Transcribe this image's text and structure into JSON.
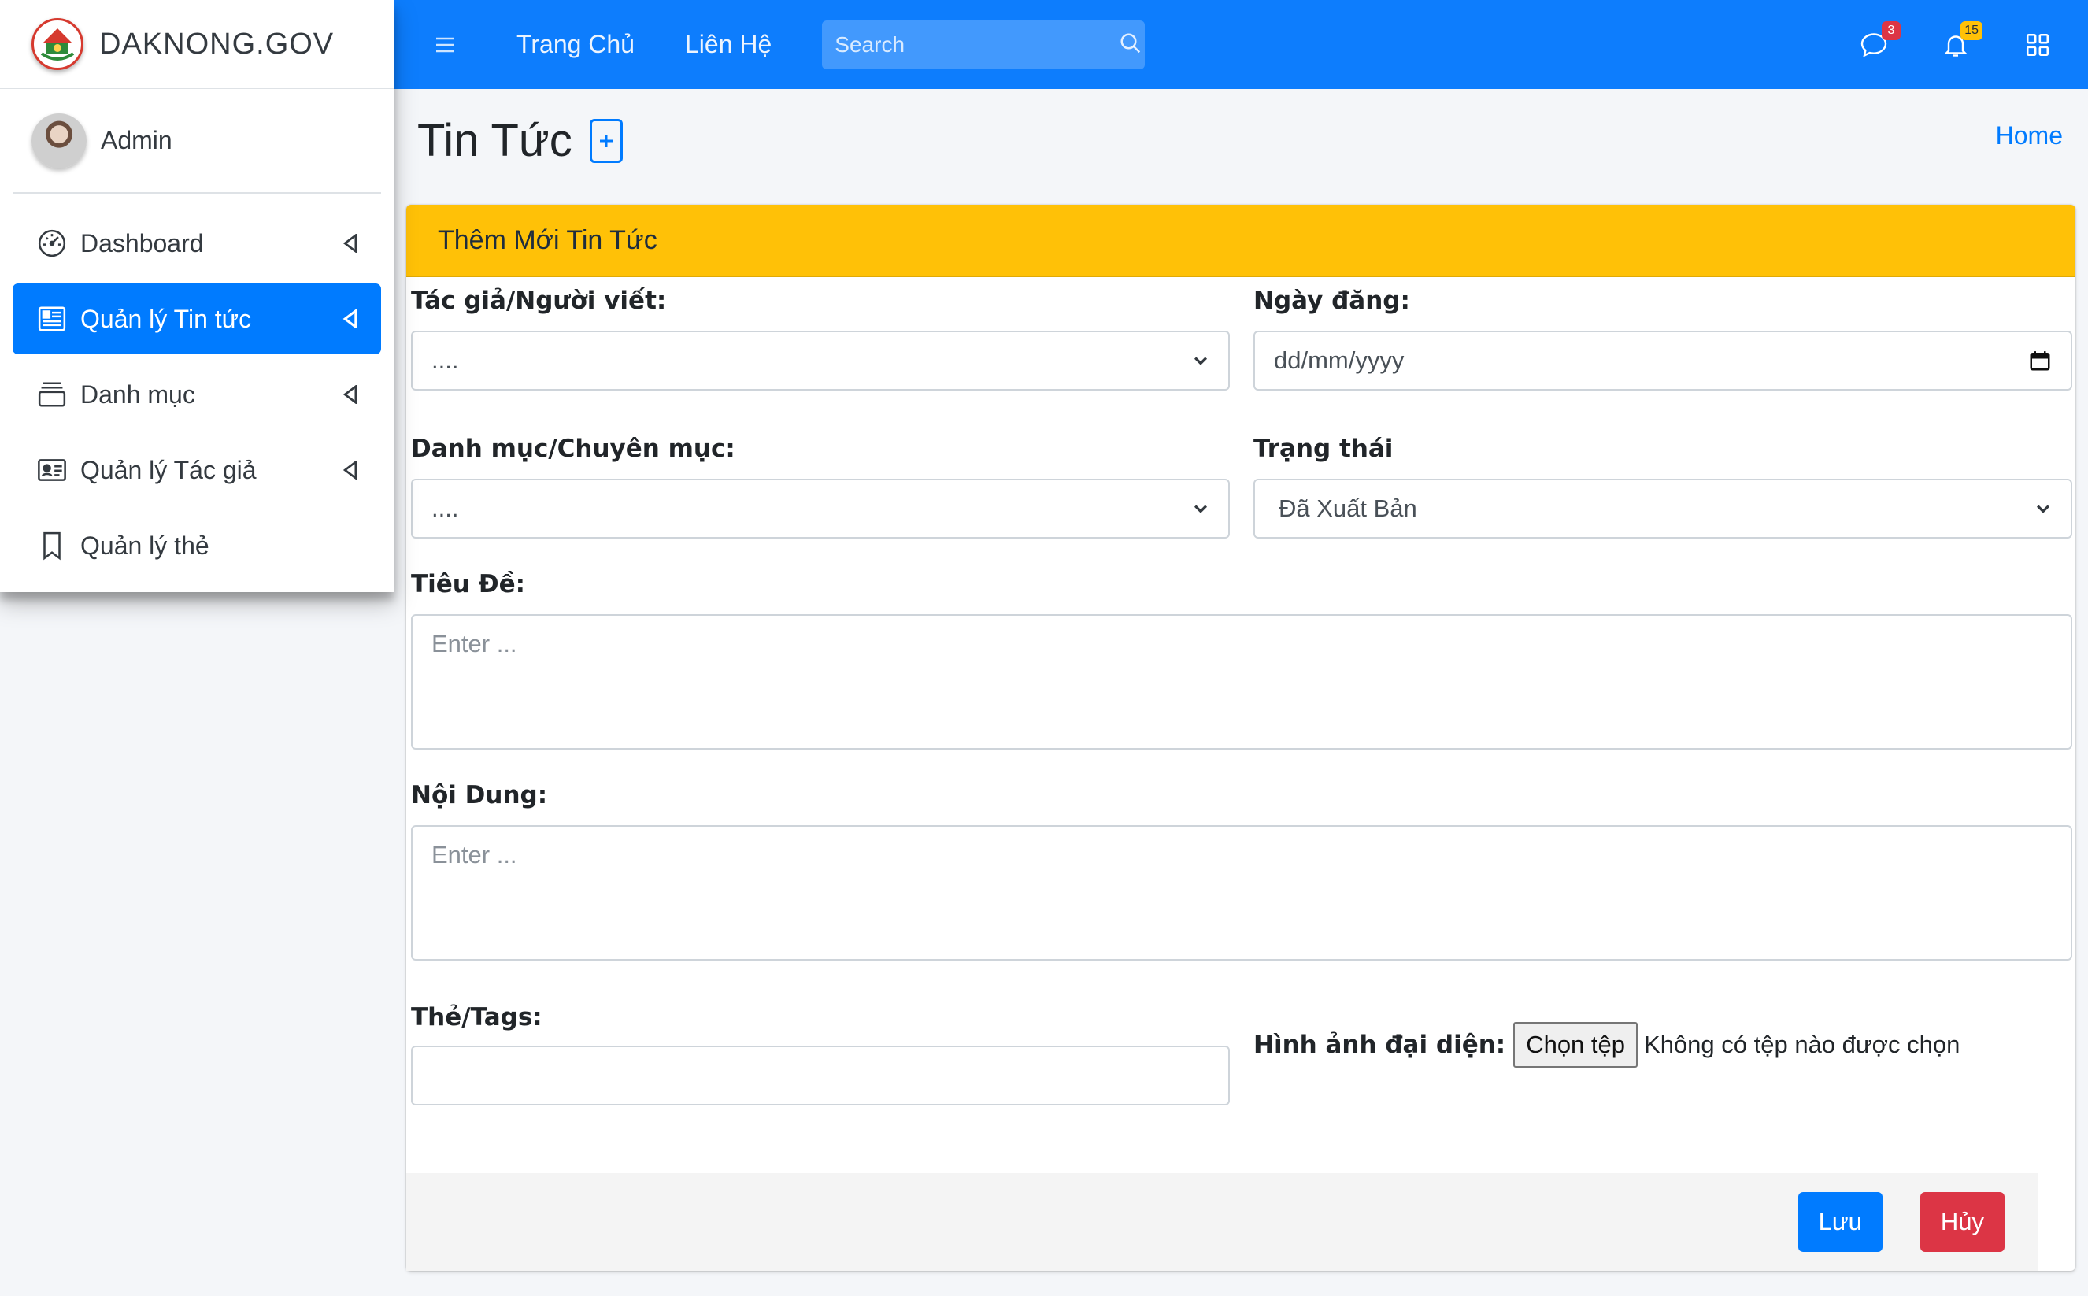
{
  "brand": {
    "name": "DAKNONG.GOV"
  },
  "user": {
    "name": "Admin"
  },
  "sidebar": {
    "items": [
      {
        "label": "Dashboard",
        "icon": "dashboard-gauge-icon",
        "active": false,
        "has_caret": true
      },
      {
        "label": "Quản lý Tin tức",
        "icon": "newspaper-icon",
        "active": true,
        "has_caret": true
      },
      {
        "label": "Danh mục",
        "icon": "layers-icon",
        "active": false,
        "has_caret": true
      },
      {
        "label": "Quản lý Tác giả",
        "icon": "id-card-icon",
        "active": false,
        "has_caret": true
      },
      {
        "label": "Quản lý thẻ",
        "icon": "bookmark-icon",
        "active": false,
        "has_caret": false
      }
    ]
  },
  "topbar": {
    "links": [
      "Trang Chủ",
      "Liên Hệ"
    ],
    "search_placeholder": "Search",
    "messages_badge": "3",
    "notifications_badge": "15"
  },
  "page": {
    "title": "Tin Tức",
    "breadcrumb": "Home"
  },
  "card": {
    "header": "Thêm Mới Tin Tức"
  },
  "form": {
    "author_label": "Tác giả/Người viết:",
    "author_value": "....",
    "date_label": "Ngày đăng:",
    "date_value": "dd/mm/yyyy",
    "category_label": "Danh mục/Chuyên mục:",
    "category_value": "....",
    "status_label": "Trạng thái",
    "status_value": "Đã Xuất Bản",
    "title_label": "Tiêu Đề:",
    "title_placeholder": "Enter ...",
    "content_label": "Nội Dung:",
    "content_placeholder": "Enter ...",
    "tags_label": "Thẻ/Tags:",
    "tags_value": "",
    "image_label": "Hình ảnh đại diện:",
    "file_button": "Chọn tệp",
    "file_status": "Không có tệp nào được chọn"
  },
  "actions": {
    "save": "Lưu",
    "cancel": "Hủy"
  },
  "colors": {
    "primary": "#007bff",
    "topbar": "#0d7dfd",
    "warning": "#ffc107",
    "danger": "#dc3545"
  }
}
